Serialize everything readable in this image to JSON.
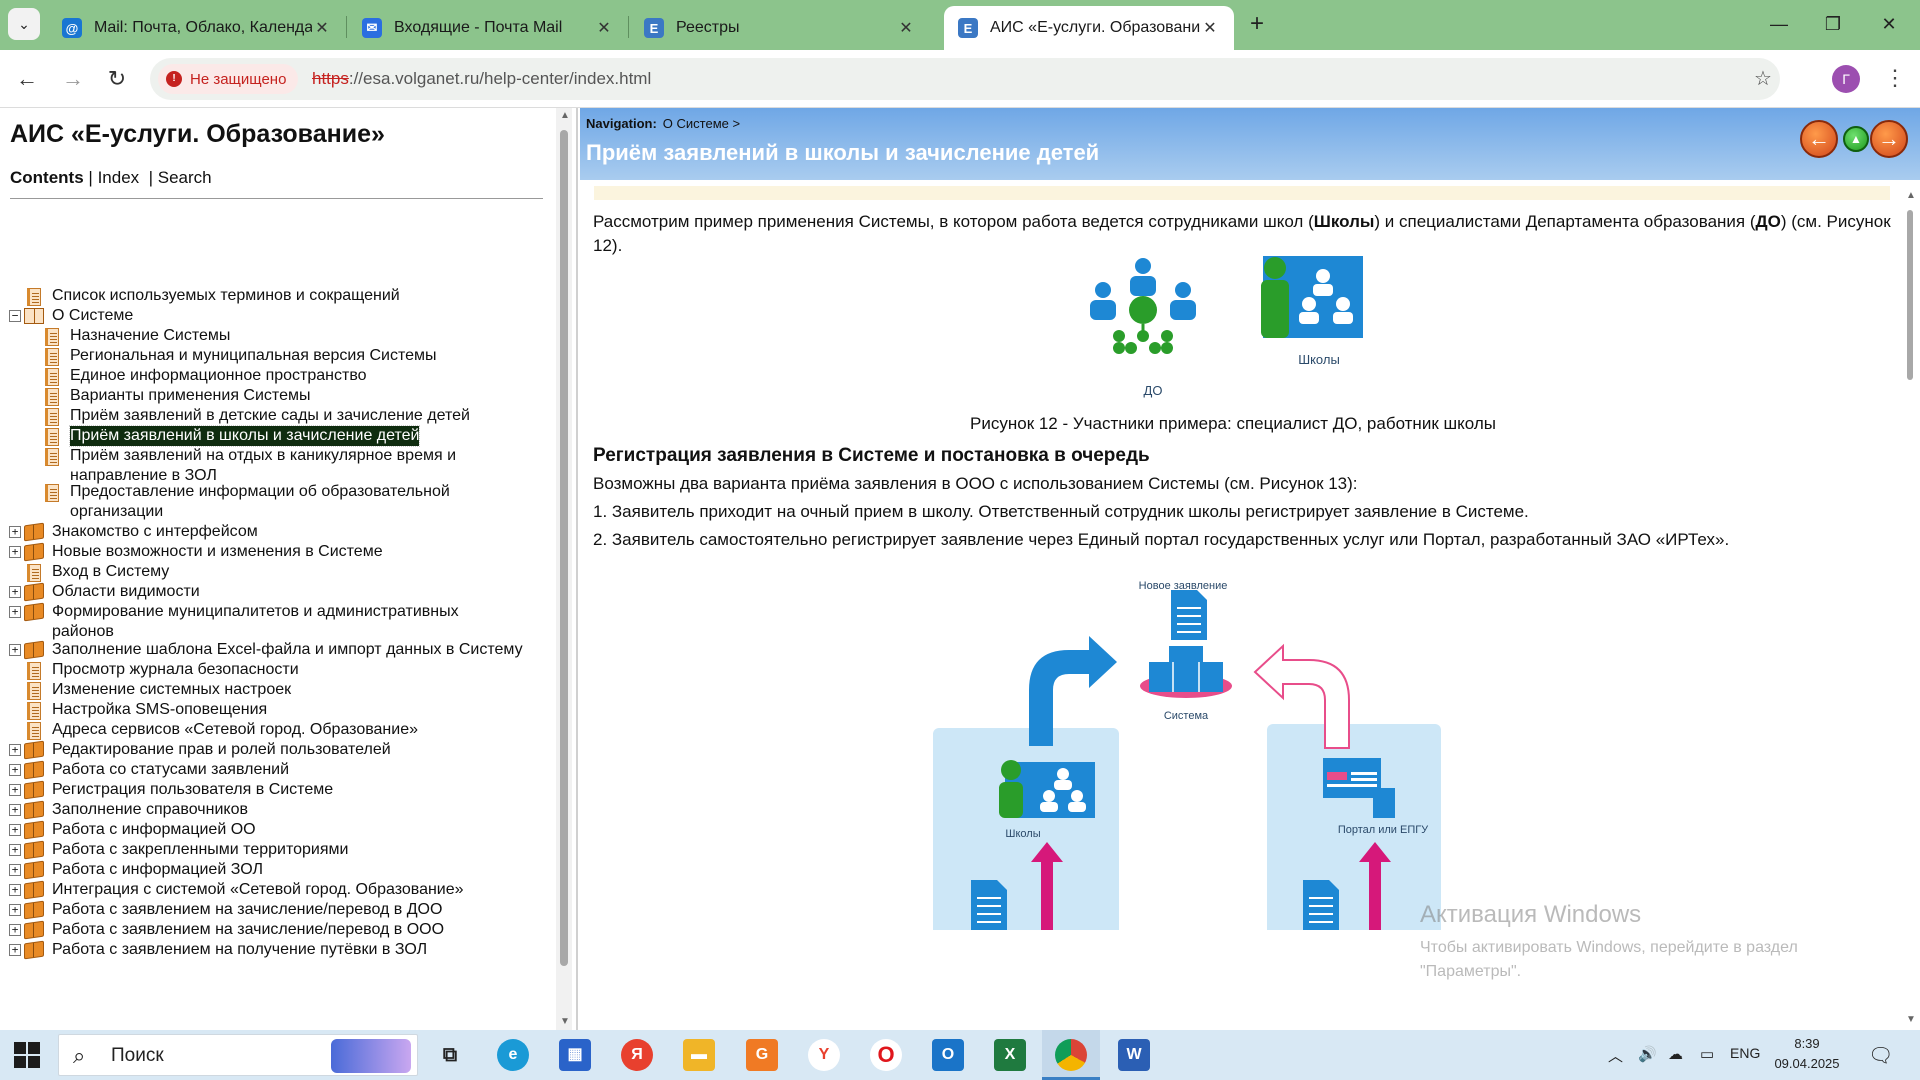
{
  "browser": {
    "tabs": [
      {
        "title": "Mail: Почта, Облако, Календарь",
        "favicon": "at-icon"
      },
      {
        "title": "Входящие - Почта Mail",
        "favicon": "mail-icon"
      },
      {
        "title": "Реестры",
        "favicon": "e-icon"
      },
      {
        "title": "АИС «Е-услуги. Образование»",
        "favicon": "e-icon",
        "active": true
      }
    ],
    "security_label": "Не защищено",
    "url_scheme": "https",
    "url_rest": "://esa.volganet.ru/help-center/index.html",
    "profile_initial": "Г"
  },
  "toc": {
    "title": "АИС «Е-услуги. Образование»",
    "nav_contents": "Contents",
    "nav_index": "Index",
    "nav_search": "Search",
    "nav_sep": "|",
    "items": [
      {
        "label": "Список используемых терминов и сокращений",
        "level": 0,
        "icon": "page",
        "toggle": ""
      },
      {
        "label": "О Системе",
        "level": 0,
        "icon": "book-open",
        "toggle": "−"
      },
      {
        "label": "Назначение Системы",
        "level": 1,
        "icon": "page",
        "toggle": ""
      },
      {
        "label": "Региональная и муниципальная версия Системы",
        "level": 1,
        "icon": "page",
        "toggle": ""
      },
      {
        "label": "Единое информационное пространство",
        "level": 1,
        "icon": "page",
        "toggle": ""
      },
      {
        "label": "Варианты применения Системы",
        "level": 1,
        "icon": "page",
        "toggle": ""
      },
      {
        "label": "Приём заявлений в детские сады и зачисление детей",
        "level": 1,
        "icon": "page",
        "toggle": ""
      },
      {
        "label": "Приём заявлений в школы и зачисление детей",
        "level": 1,
        "icon": "page",
        "toggle": "",
        "selected": true
      },
      {
        "label": "Приём заявлений на отдых в каникулярное время и направление в ЗОЛ",
        "level": 1,
        "icon": "page",
        "toggle": ""
      },
      {
        "label": "Предоставление информации об образовательной организации",
        "level": 1,
        "icon": "page",
        "toggle": ""
      },
      {
        "label": "Знакомство с интерфейсом",
        "level": 0,
        "icon": "book",
        "toggle": "+"
      },
      {
        "label": "Новые возможности и изменения в Системе",
        "level": 0,
        "icon": "book",
        "toggle": "+"
      },
      {
        "label": "Вход в Систему",
        "level": 0,
        "icon": "page",
        "toggle": ""
      },
      {
        "label": "Области видимости",
        "level": 0,
        "icon": "book",
        "toggle": "+"
      },
      {
        "label": "Формирование муниципалитетов и административных районов",
        "level": 0,
        "icon": "book",
        "toggle": "+"
      },
      {
        "label": "Заполнение шаблона Excel-файла и импорт данных в Систему",
        "level": 0,
        "icon": "book",
        "toggle": "+"
      },
      {
        "label": "Просмотр журнала безопасности",
        "level": 0,
        "icon": "page",
        "toggle": ""
      },
      {
        "label": "Изменение системных настроек",
        "level": 0,
        "icon": "page",
        "toggle": ""
      },
      {
        "label": "Настройка SMS-оповещения",
        "level": 0,
        "icon": "page",
        "toggle": ""
      },
      {
        "label": "Адреса сервисов «Сетевой город. Образование»",
        "level": 0,
        "icon": "page",
        "toggle": ""
      },
      {
        "label": "Редактирование прав и ролей пользователей",
        "level": 0,
        "icon": "book",
        "toggle": "+"
      },
      {
        "label": "Работа со статусами заявлений",
        "level": 0,
        "icon": "book",
        "toggle": "+"
      },
      {
        "label": "Регистрация пользователя в Системе",
        "level": 0,
        "icon": "book",
        "toggle": "+"
      },
      {
        "label": "Заполнение справочников",
        "level": 0,
        "icon": "book",
        "toggle": "+"
      },
      {
        "label": "Работа с информацией ОО",
        "level": 0,
        "icon": "book",
        "toggle": "+"
      },
      {
        "label": "Работа с закрепленными территориями",
        "level": 0,
        "icon": "book",
        "toggle": "+"
      },
      {
        "label": "Работа с информацией ЗОЛ",
        "level": 0,
        "icon": "book",
        "toggle": "+"
      },
      {
        "label": "Интеграция с системой «Сетевой город. Образование»",
        "level": 0,
        "icon": "book",
        "toggle": "+"
      },
      {
        "label": "Работа с заявлением на зачисление/перевод в ДОО",
        "level": 0,
        "icon": "book",
        "toggle": "+"
      },
      {
        "label": "Работа с заявлением на зачисление/перевод в ООО",
        "level": 0,
        "icon": "book",
        "toggle": "+"
      },
      {
        "label": "Работа с заявлением на получение путёвки в ЗОЛ",
        "level": 0,
        "icon": "book",
        "toggle": "+"
      }
    ]
  },
  "page": {
    "nav_label": "Navigation:",
    "nav_path": "О Системе >",
    "title": "Приём заявлений в школы и зачисление детей",
    "intro_a": "Рассмотрим пример применения Системы, в котором работа ведется сотрудниками школ (",
    "intro_b": "Школы",
    "intro_c": ") и специалистами Департамента образования (",
    "intro_d": "ДО",
    "intro_e": ") (см. Рисунок 12).",
    "fig12_label_do": "ДО",
    "fig12_label_schools": "Школы",
    "fig12_caption": "Рисунок 12 - Участники примера: специалист ДО, работник школы",
    "section_heading": "Регистрация заявления в Системе и постановка в очередь",
    "section_text": "Возможны два варианта приёма заявления в ООО с использованием Системы (см. Рисунок 13):",
    "list_item_1": "1. Заявитель приходит на очный прием в школу. Ответственный сотрудник школы регистрирует заявление в Системе.",
    "list_item_2": "2. Заявитель самостоятельно регистрирует заявление через Единый портал государственных услуг или Портал, разработанный ЗАО «ИРТех».",
    "fig13_new_app": "Новое заявление",
    "fig13_system": "Система",
    "fig13_schools": "Школы",
    "fig13_portal": "Портал или ЕПГУ"
  },
  "watermark": {
    "title": "Активация Windows",
    "text": "Чтобы активировать Windows, перейдите в раздел \"Параметры\"."
  },
  "taskbar": {
    "search_placeholder": "Поиск",
    "lang": "ENG",
    "time": "8:39",
    "date": "09.04.2025"
  },
  "colors": {
    "tabbar": "#8cc48c",
    "header_top": "#6fa7e6",
    "selected_bg": "#0f2c0f",
    "accent_blue": "#1e88d4",
    "accent_green": "#2a9d2a",
    "accent_pink": "#d6187a"
  }
}
